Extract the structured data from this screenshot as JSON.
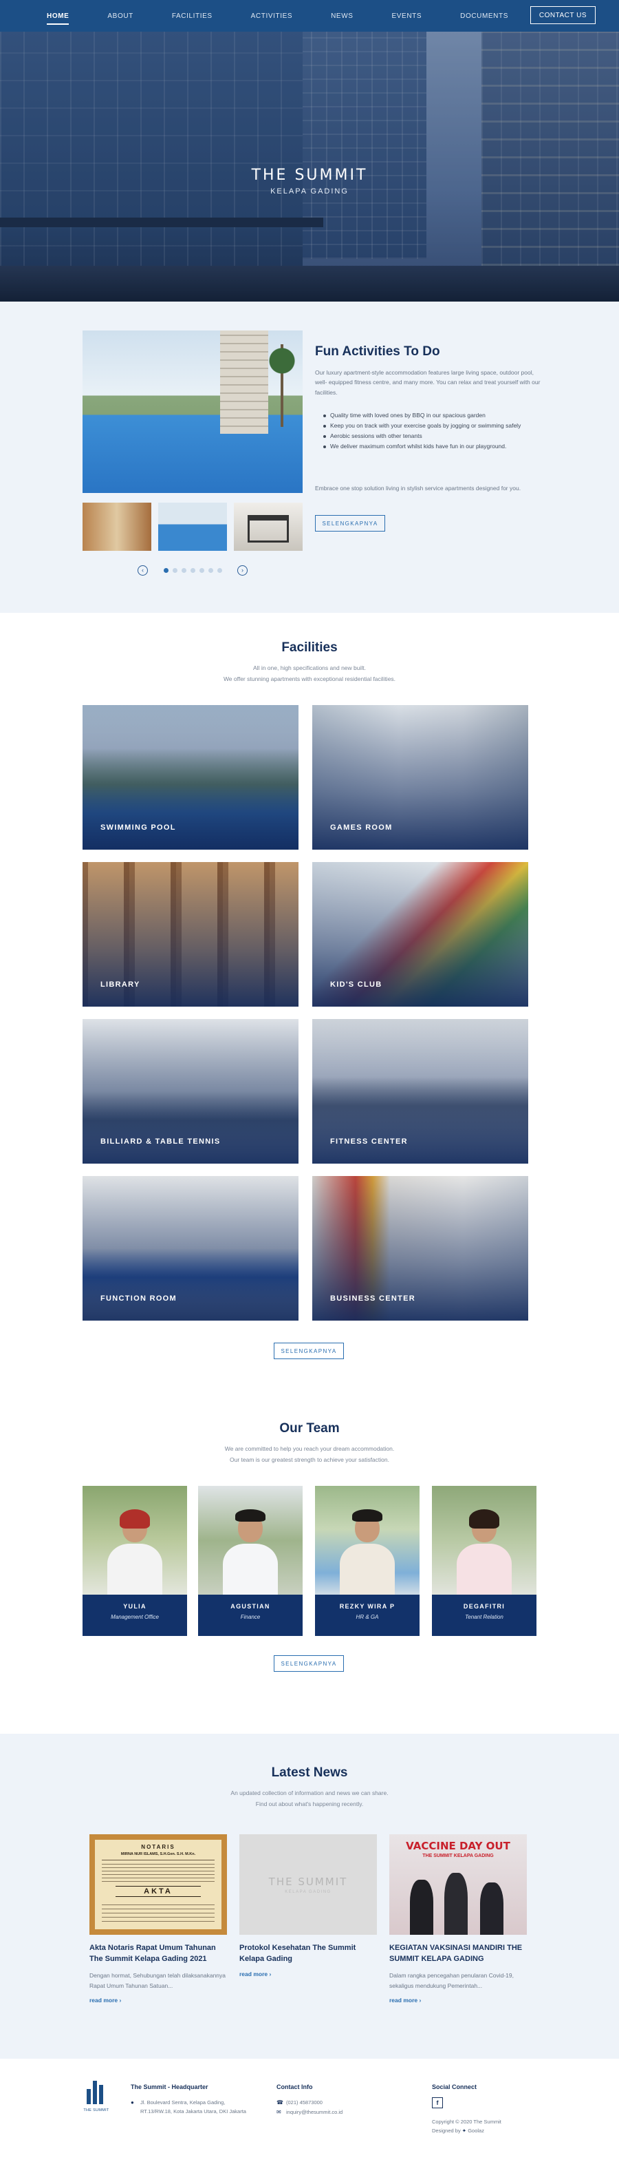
{
  "nav": {
    "items": [
      {
        "label": "HOME"
      },
      {
        "label": "ABOUT"
      },
      {
        "label": "FACILITIES"
      },
      {
        "label": "ACTIVITIES"
      },
      {
        "label": "NEWS"
      },
      {
        "label": "EVENTS"
      },
      {
        "label": "DOCUMENTS"
      }
    ],
    "contact": "CONTACT US"
  },
  "hero": {
    "title": "THE SUMMIT",
    "subtitle": "KELAPA GADING"
  },
  "activities": {
    "title": "Fun Activities To Do",
    "description": "Our luxury apartment-style accommodation features large living space, outdoor pool, well- equipped fitness centre, and many more. You can relax and treat yourself with our facilities.",
    "list": [
      "Quality time with loved ones by BBQ in our spacious garden",
      "Keep you on track with your exercise goals by jogging or swimming safely",
      "Aerobic sessions with other tenants",
      "We deliver maximum comfort whilst kids have fun in our playground."
    ],
    "footer": "Embrace one stop solution living in stylish service apartments designed for you.",
    "button": "SELENGKAPNYA",
    "prev_icon": "chevron-left-icon",
    "next_icon": "chevron-right-icon",
    "slide_count": 7,
    "active_slide": 1
  },
  "facilities": {
    "title": "Facilities",
    "subtitle_1": "All in one, high specifications and new built.",
    "subtitle_2": "We offer stunning apartments with exceptional residential facilities.",
    "items": [
      {
        "label": "SWIMMING POOL"
      },
      {
        "label": "GAMES ROOM"
      },
      {
        "label": "LIBRARY"
      },
      {
        "label": "KID'S CLUB"
      },
      {
        "label": "BILLIARD & TABLE TENNIS"
      },
      {
        "label": "FITNESS CENTER"
      },
      {
        "label": "FUNCTION ROOM"
      },
      {
        "label": "BUSINESS CENTER"
      }
    ],
    "button": "SELENGKAPNYA"
  },
  "team": {
    "title": "Our Team",
    "subtitle_1": "We are committed to help you reach your dream accommodation.",
    "subtitle_2": "Our team is our greatest strength to achieve your satisfaction.",
    "members": [
      {
        "name": "YULIA",
        "role": "Management Office"
      },
      {
        "name": "AGUSTIAN",
        "role": "Finance"
      },
      {
        "name": "REZKY WIRA P",
        "role": "HR & GA"
      },
      {
        "name": "DEGAFITRI",
        "role": "Tenant Relation"
      }
    ],
    "button": "SELENGKAPNYA"
  },
  "news": {
    "title": "Latest News",
    "subtitle_1": "An updated collection of information and news we can share.",
    "subtitle_2": "Find out about what's happening recently.",
    "items": [
      {
        "title": "Akta Notaris Rapat Umum Tahunan The Summit Kelapa Gading 2021",
        "excerpt": "Dengan hormat, Sehubungan telah dilaksanakannya Rapat Umum Tahunan Satuan...",
        "more": "read more",
        "img_line_1": "NOTARIS",
        "img_line_2": "MIRNA NUR ISLAMS, S.H.Gen. S.H. M.Kn.",
        "img_line_3": "AKTA"
      },
      {
        "title": "Protokol Kesehatan The Summit Kelapa Gading",
        "excerpt": "",
        "more": "read more",
        "img_line_1": "THE SUMMIT",
        "img_line_2": "KELAPA GADING"
      },
      {
        "title": "KEGIATAN VAKSINASI MANDIRI THE SUMMIT KELAPA GADING",
        "excerpt": "Dalam rangka pencegahan penularan Covid-19, sekaligus mendukung Pemerintah...",
        "more": "read more",
        "img_line_1": "VACCINE DAY OUT",
        "img_line_2": "THE SUMMIT KELAPA GADING"
      }
    ]
  },
  "footer": {
    "logo_text": "THE SUMMIT",
    "hq_title": "The Summit - Headquarter",
    "address_1": "Jl. Boulevard Sentra, Kelapa Gading,",
    "address_2": "RT.13/RW.18, Kota Jakarta Utara, DKI Jakarta",
    "contact_title": "Contact Info",
    "phone": "(021) 45873000",
    "email": "inquiry@thesummit.co.id",
    "social_title": "Social Connect",
    "social_icon": "facebook-icon",
    "facebook_glyph": "f",
    "copyright": "Copyright © 2020 The Summit",
    "designed_by": "Designed by",
    "designer": "Goolaz"
  },
  "colors": {
    "nav": "#1c4f86",
    "accent": "#2a6eb0",
    "heading": "#17305a",
    "team_card": "#12326a",
    "section_bg": "#eef3f9"
  }
}
